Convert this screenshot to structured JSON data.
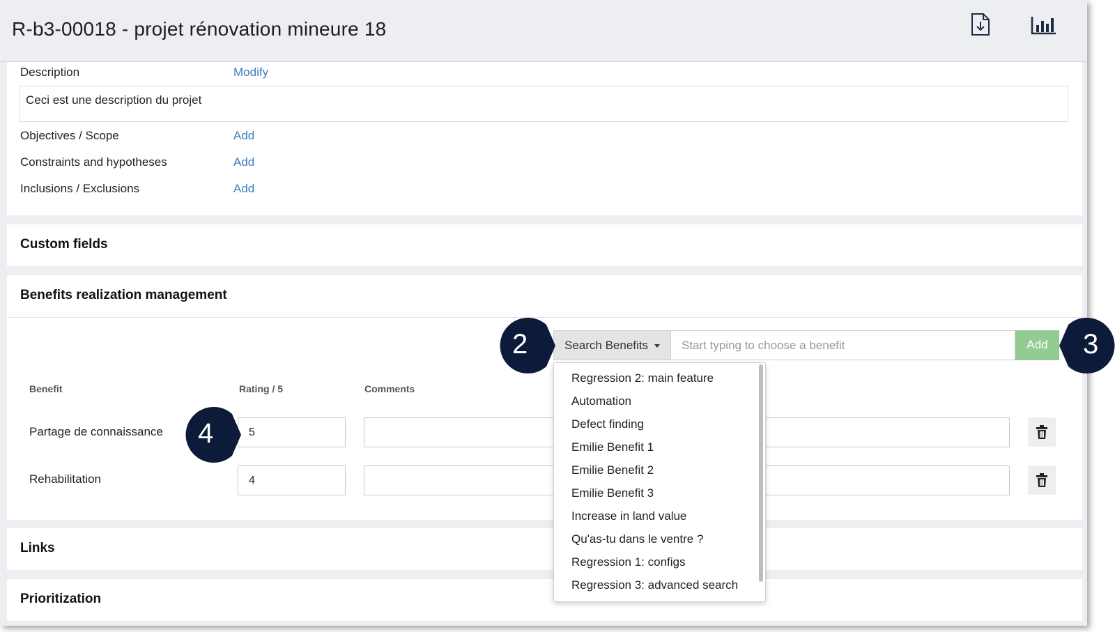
{
  "header": {
    "title": "R-b3-00018 - projet rénovation mineure 18",
    "export_icon": "file-download-icon",
    "report_icon": "bar-chart-icon"
  },
  "description": {
    "label": "Description",
    "modify_label": "Modify",
    "text": "Ceci est une description du projet"
  },
  "fields": [
    {
      "label": "Objectives / Scope",
      "action": "Add"
    },
    {
      "label": "Constraints and hypotheses",
      "action": "Add"
    },
    {
      "label": "Inclusions / Exclusions",
      "action": "Add"
    }
  ],
  "sections": {
    "custom_fields": "Custom fields",
    "benefits": "Benefits realization management",
    "links": "Links",
    "prioritization": "Prioritization"
  },
  "benefits": {
    "search_button": "Search Benefits",
    "search_placeholder": "Start typing to choose a benefit",
    "add_label": "Add",
    "columns": {
      "benefit": "Benefit",
      "rating": "Rating / 5",
      "comments": "Comments"
    },
    "rows": [
      {
        "benefit": "Partage de connaissance",
        "rating": "5",
        "comments": ""
      },
      {
        "benefit": "Rehabilitation",
        "rating": "4",
        "comments": ""
      }
    ],
    "dropdown_options": [
      "Regression 2: main feature",
      "Automation",
      "Defect finding",
      "Emilie Benefit 1",
      "Emilie Benefit 2",
      "Emilie Benefit 3",
      "Increase in land value",
      "Qu'as-tu dans le ventre ?",
      "Regression 1: configs",
      "Regression 3: advanced search"
    ]
  },
  "callouts": {
    "c2": "2",
    "c3": "3",
    "c4": "4"
  },
  "colors": {
    "link": "#3a7fc1",
    "add_button": "#92cc92",
    "callout": "#0d1b3a"
  }
}
